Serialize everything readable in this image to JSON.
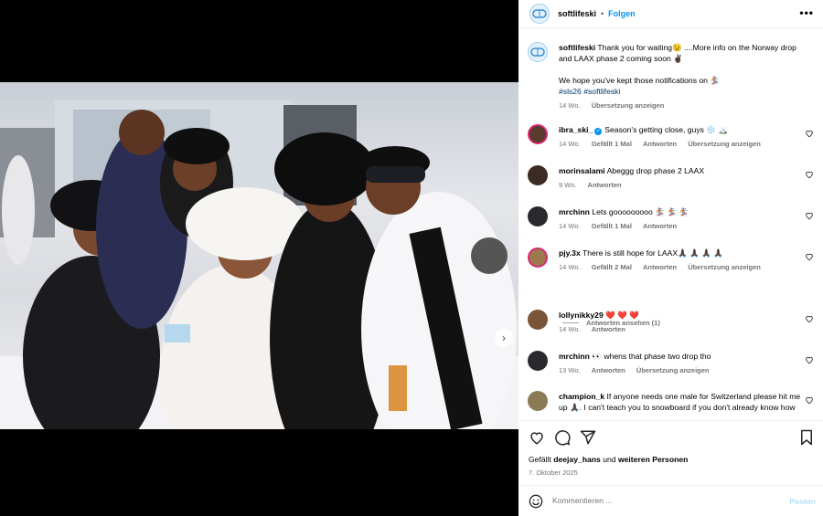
{
  "post": {
    "username": "softlifeski",
    "separator": "•",
    "follow_label": "Folgen",
    "more_label": "•••",
    "caption": {
      "username": "softlifeski",
      "text_line1": "Thank you for waiting😉 ....More info on the Norway drop and LAAX phase 2 coming soon ✌🏿",
      "text_line2": "We hope you've kept those notifications on 🏂",
      "hashtags": "#sls26 #softlifeski",
      "age": "14 Wo.",
      "translate": "Übersetzung anzeigen"
    }
  },
  "comments": [
    {
      "username": "ibra_ski_",
      "verified": true,
      "text": "Season's getting close, guys ❄️ 🏔️",
      "age": "14 Wo.",
      "likes": "Gefällt 1 Mal",
      "reply": "Antworten",
      "translate": "Übersetzung anzeigen"
    },
    {
      "username": "morinsalami",
      "text": "Abeggg drop phase 2 LAAX",
      "age": "9 Wo.",
      "reply": "Antworten"
    },
    {
      "username": "mrchinn",
      "text": "Lets gooooooooo 🏂 🏂 🏂",
      "age": "14 Wo.",
      "likes": "Gefällt 1 Mal",
      "reply": "Antworten"
    },
    {
      "username": "pjy.3x",
      "text": "There is still hope for LAAX🙏🏿 🙏🏿 🙏🏿 🙏🏿",
      "age": "14 Wo.",
      "likes": "Gefällt 2 Mal",
      "reply": "Antworten",
      "translate": "Übersetzung anzeigen"
    },
    {
      "username": "lollynikky29",
      "text": "❤️ ❤️ ❤️",
      "age": "14 Wo.",
      "reply": "Antworten"
    },
    {
      "username": "mrchinn",
      "text": "👀 whens that phase two drop tho",
      "age": "13 Wo.",
      "reply": "Antworten",
      "translate": "Übersetzung anzeigen"
    },
    {
      "username": "champion_k",
      "text": "If anyone needs one male for Switzerland please hit me up 🙏🏿. I can't teach you to snowboard if you don't already know how",
      "age": "",
      "reply": ""
    }
  ],
  "view_replies": "Antworten ansehen (1)",
  "footer": {
    "likes_prefix": "Gefällt",
    "likes_user": "deejay_hans",
    "likes_mid": "und",
    "likes_rest": "weiteren Personen",
    "date": "7. Oktober 2025",
    "comment_placeholder": "Kommentieren ...",
    "post_label": "Posten"
  },
  "icons": {
    "heart": "heart-icon",
    "comment": "comment-icon",
    "share": "share-icon",
    "bookmark": "bookmark-icon",
    "emoji": "emoji-icon",
    "more": "more-icon",
    "next": "chevron-right-icon"
  },
  "colors": {
    "link_blue": "#0095f6",
    "secondary_text": "#737373",
    "post_disabled": "#b2dffc"
  }
}
